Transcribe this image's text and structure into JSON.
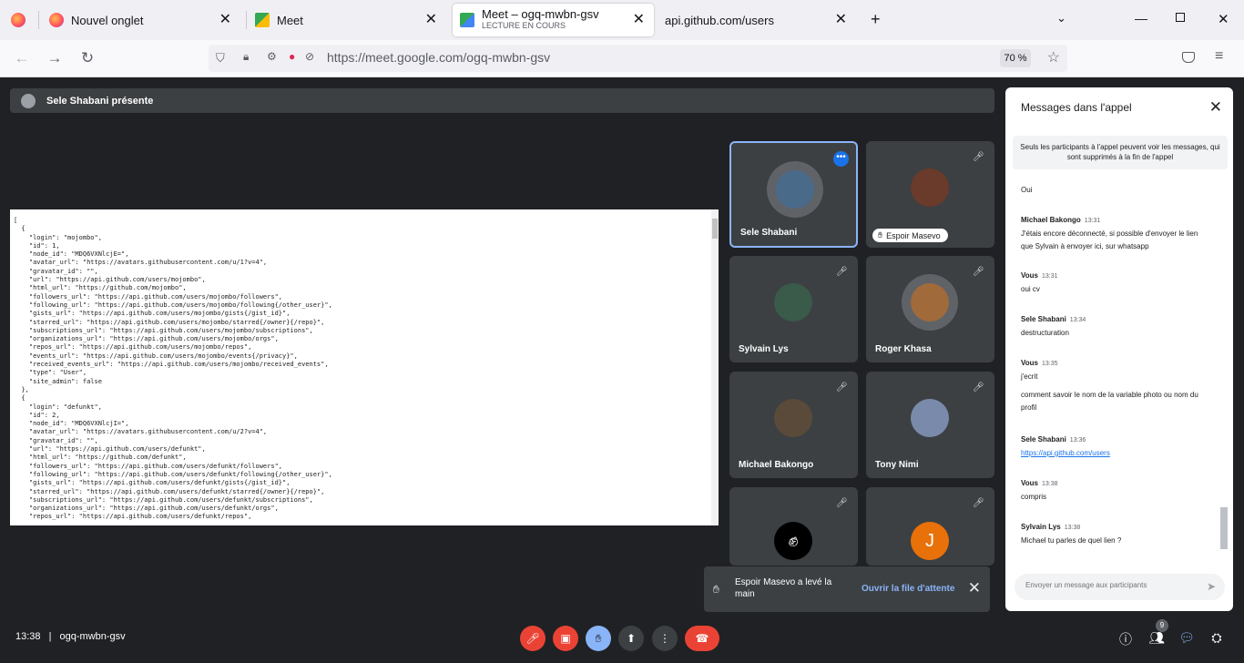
{
  "browser": {
    "tabs": [
      {
        "title": "Nouvel onglet"
      },
      {
        "title": "Meet"
      },
      {
        "title": "Meet – ogq-mwbn-gsv",
        "subtitle": "LECTURE EN COURS"
      },
      {
        "title": "api.github.com/users"
      }
    ],
    "url": "https://meet.google.com/ogq-mwbn-gsv",
    "zoom": "70 %"
  },
  "presenter": "Sele Shabani présente",
  "share_code": "[\n  {\n    \"login\": \"mojombo\",\n    \"id\": 1,\n    \"node_id\": \"MDQ6VXNlcjE=\",\n    \"avatar_url\": \"https://avatars.githubusercontent.com/u/1?v=4\",\n    \"gravatar_id\": \"\",\n    \"url\": \"https://api.github.com/users/mojombo\",\n    \"html_url\": \"https://github.com/mojombo\",\n    \"followers_url\": \"https://api.github.com/users/mojombo/followers\",\n    \"following_url\": \"https://api.github.com/users/mojombo/following{/other_user}\",\n    \"gists_url\": \"https://api.github.com/users/mojombo/gists{/gist_id}\",\n    \"starred_url\": \"https://api.github.com/users/mojombo/starred{/owner}{/repo}\",\n    \"subscriptions_url\": \"https://api.github.com/users/mojombo/subscriptions\",\n    \"organizations_url\": \"https://api.github.com/users/mojombo/orgs\",\n    \"repos_url\": \"https://api.github.com/users/mojombo/repos\",\n    \"events_url\": \"https://api.github.com/users/mojombo/events{/privacy}\",\n    \"received_events_url\": \"https://api.github.com/users/mojombo/received_events\",\n    \"type\": \"User\",\n    \"site_admin\": false\n  },\n  {\n    \"login\": \"defunkt\",\n    \"id\": 2,\n    \"node_id\": \"MDQ6VXNlcjI=\",\n    \"avatar_url\": \"https://avatars.githubusercontent.com/u/2?v=4\",\n    \"gravatar_id\": \"\",\n    \"url\": \"https://api.github.com/users/defunkt\",\n    \"html_url\": \"https://github.com/defunkt\",\n    \"followers_url\": \"https://api.github.com/users/defunkt/followers\",\n    \"following_url\": \"https://api.github.com/users/defunkt/following{/other_user}\",\n    \"gists_url\": \"https://api.github.com/users/defunkt/gists{/gist_id}\",\n    \"starred_url\": \"https://api.github.com/users/defunkt/starred{/owner}{/repo}\",\n    \"subscriptions_url\": \"https://api.github.com/users/defunkt/subscriptions\",\n    \"organizations_url\": \"https://api.github.com/users/defunkt/orgs\",\n    \"repos_url\": \"https://api.github.com/users/defunkt/repos\",",
  "participants": [
    {
      "name": "Sele Shabani",
      "color": "#4a6a8a"
    },
    {
      "name": "Espoir Masevo",
      "color": "#6a3a2a",
      "chip": "Espoir Masevo"
    },
    {
      "name": "Sylvain Lys",
      "color": "#3a5a4a"
    },
    {
      "name": "Roger Khasa",
      "color": "#a06a3a"
    },
    {
      "name": "Michael Bakongo",
      "color": "#5a4a3a"
    },
    {
      "name": "Tony Nimi",
      "color": "#7a8aaa"
    },
    {
      "name": "",
      "color": "#000000"
    },
    {
      "name": "",
      "letter": "J",
      "color": "#e8710a"
    }
  ],
  "toast": {
    "message": "Espoir Masevo a levé la main",
    "link": "Ouvrir la file d'attente"
  },
  "chat": {
    "title": "Messages dans l'appel",
    "notice": "Seuls les participants à l'appel peuvent voir les messages, qui sont supprimés à la fin de l'appel",
    "messages": [
      {
        "text": "Oui"
      },
      {
        "who": "Michael Bakongo",
        "time": "13:31",
        "text": "J'étais encore déconnecté, si possible d'envoyer le lien que Sylvain à envoyer ici, sur whatsapp"
      },
      {
        "who": "Vous",
        "time": "13:31",
        "text": "oui cv"
      },
      {
        "who": "Sele Shabani",
        "time": "13:34",
        "text": "destructuration"
      },
      {
        "who": "Vous",
        "time": "13:35",
        "text": "j'ecrit"
      },
      {
        "text": "comment savoir le nom de la variable photo ou nom du profil"
      },
      {
        "who": "Sele Shabani",
        "time": "13:36",
        "link": "https://api.github.com/users"
      },
      {
        "who": "Vous",
        "time": "13:38",
        "text": "compris"
      },
      {
        "who": "Sylvain Lys",
        "time": "13:38",
        "text": "Michael tu parles de quel lien ?"
      }
    ],
    "input_placeholder": "Envoyer un message aux participants"
  },
  "footer": {
    "time": "13:38",
    "meeting": "ogq-mwbn-gsv",
    "people_count": "9"
  }
}
